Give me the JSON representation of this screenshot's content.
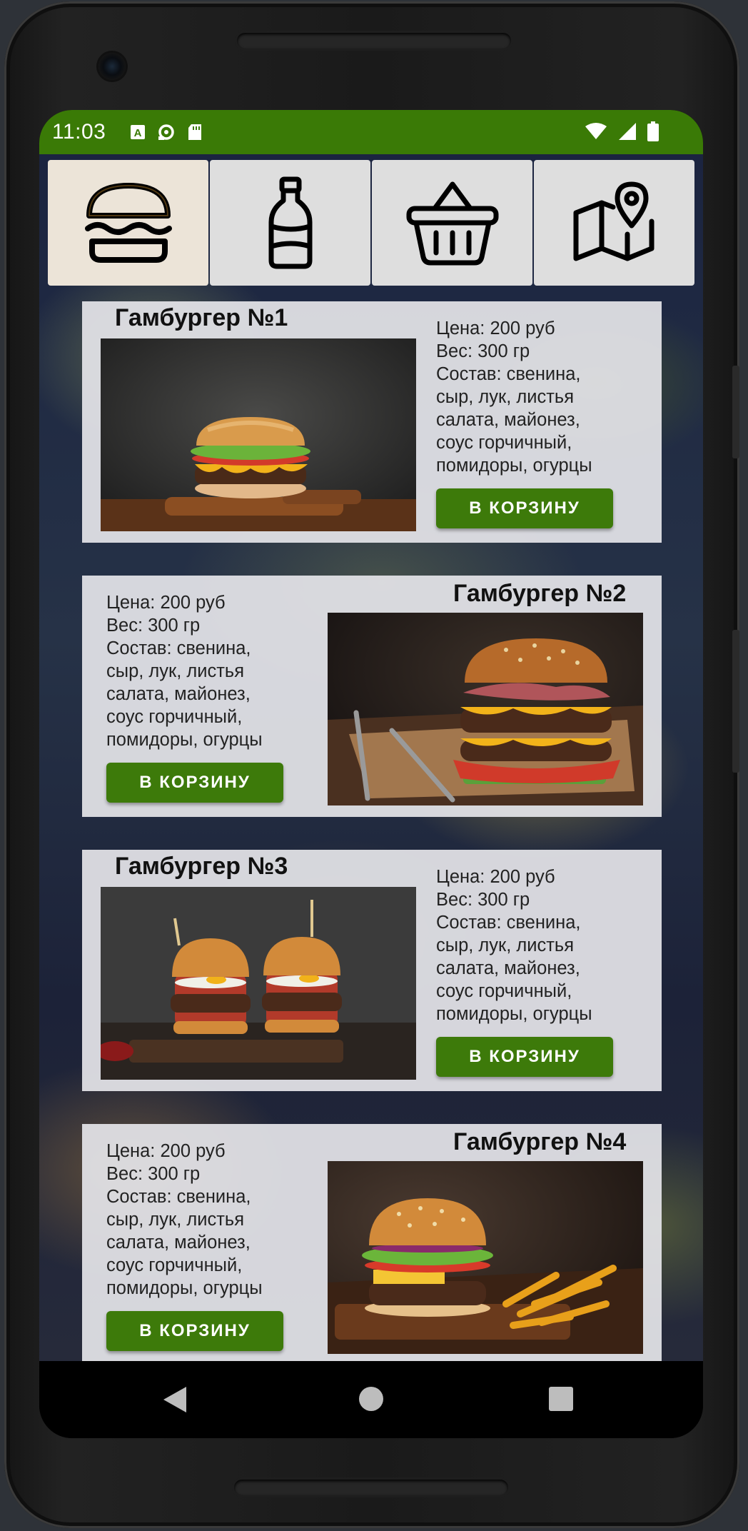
{
  "status": {
    "time": "11:03",
    "accent_color": "#3a7a06",
    "left_icons": [
      "accessibility-icon",
      "sync-icon",
      "sd-card-icon"
    ],
    "right_icons": [
      "wifi-icon",
      "signal-icon",
      "battery-icon"
    ]
  },
  "tabs": [
    {
      "icon": "burger-icon",
      "active": true
    },
    {
      "icon": "bottle-icon",
      "active": false
    },
    {
      "icon": "basket-icon",
      "active": false
    },
    {
      "icon": "map-pin-icon",
      "active": false
    }
  ],
  "items": [
    {
      "title": "Гамбургер №1",
      "price": "Цена: 200 руб",
      "weight": "Вес: 300 гр",
      "composition_lines": [
        "Состав: свенина,",
        "сыр, лук, листья",
        "салата, майонез,",
        "соус горчичный,",
        "помидоры, огурцы"
      ],
      "button": "В КОРЗИНУ"
    },
    {
      "title": "Гамбургер №2",
      "price": "Цена: 200 руб",
      "weight": "Вес: 300 гр",
      "composition_lines": [
        "Состав: свенина,",
        "сыр, лук, листья",
        "салата, майонез,",
        "соус горчичный,",
        "помидоры, огурцы"
      ],
      "button": "В КОРЗИНУ"
    },
    {
      "title": "Гамбургер №3",
      "price": "Цена: 200 руб",
      "weight": "Вес: 300 гр",
      "composition_lines": [
        "Состав: свенина,",
        "сыр, лук, листья",
        "салата, майонез,",
        "соус горчичный,",
        "помидоры, огурцы"
      ],
      "button": "В КОРЗИНУ"
    },
    {
      "title": "Гамбургер №4",
      "price": "Цена: 200 руб",
      "weight": "Вес: 300 гр",
      "composition_lines": [
        "Состав: свенина,",
        "сыр, лук, листья",
        "салата, майонез,",
        "соус горчичный,",
        "помидоры, огурцы"
      ],
      "button": "В КОРЗИНУ"
    }
  ],
  "navbar": {
    "icons": [
      "back-icon",
      "home-icon",
      "recents-icon"
    ]
  }
}
